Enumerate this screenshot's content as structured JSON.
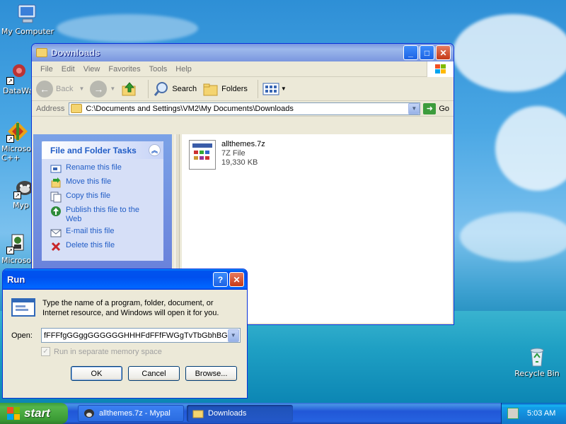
{
  "desktop": {
    "icons": [
      {
        "label": "My Computer",
        "icon": "my-computer-icon"
      },
      {
        "label": "DataWa",
        "icon": "datawa-shortcut-icon"
      },
      {
        "label": "Microsoft C++",
        "icon": "microsoft-cpp-shortcut-icon"
      },
      {
        "label": "Myp",
        "icon": "mypal-shortcut-icon"
      },
      {
        "label": "Microsoft",
        "icon": "microsoft-shortcut-icon"
      },
      {
        "label": "Recycle Bin",
        "icon": "recycle-bin-icon"
      }
    ]
  },
  "explorer": {
    "title": "Downloads",
    "menu": [
      "File",
      "Edit",
      "View",
      "Favorites",
      "Tools",
      "Help"
    ],
    "toolbar": {
      "back": "Back",
      "search": "Search",
      "folders": "Folders"
    },
    "address": {
      "label": "Address",
      "value": "C:\\Documents and Settings\\VM2\\My Documents\\Downloads",
      "go": "Go"
    },
    "task_pane": {
      "title": "File and Folder Tasks",
      "items": [
        {
          "label": "Rename this file",
          "icon": "rename-icon"
        },
        {
          "label": "Move this file",
          "icon": "move-icon"
        },
        {
          "label": "Copy this file",
          "icon": "copy-icon"
        },
        {
          "label": "Publish this file to the Web",
          "icon": "publish-web-icon"
        },
        {
          "label": "E-mail this file",
          "icon": "email-icon"
        },
        {
          "label": "Delete this file",
          "icon": "delete-icon"
        }
      ]
    },
    "file": {
      "name": "allthemes.7z",
      "type": "7Z File",
      "size": "19,330 KB"
    }
  },
  "run_dialog": {
    "title": "Run",
    "description": "Type the name of a program, folder, document, or Internet resource, and Windows will open it for you.",
    "open_label": "Open:",
    "open_value": "fFFFfgGGggGGGGGGHHHFdFFfFWGgTvTbGbhBG",
    "checkbox_label": "Run in separate memory space",
    "buttons": {
      "ok": "OK",
      "cancel": "Cancel",
      "browse": "Browse..."
    }
  },
  "taskbar": {
    "start": "start",
    "tasks": [
      {
        "label": "allthemes.7z - Mypal",
        "icon": "mypal-icon"
      },
      {
        "label": "Downloads",
        "icon": "folder-icon"
      }
    ],
    "clock": "5:03 AM"
  },
  "colors": {
    "title_blue": "#0053ee",
    "task_link": "#215dc6",
    "start_green": "#3c9c3c"
  }
}
